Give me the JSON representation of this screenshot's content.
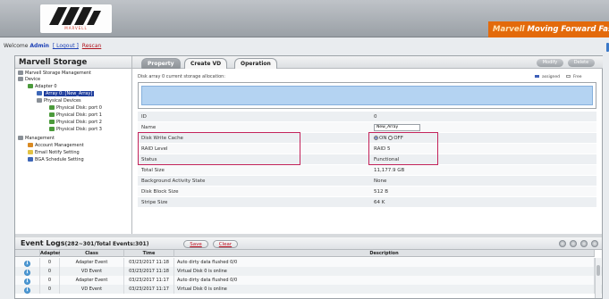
{
  "header": {
    "brand": "MARVELL",
    "tagline_accent": "Marvell",
    "tagline": "Moving Forward Faster"
  },
  "welcome": {
    "prefix": "Welcome",
    "user": "Admin",
    "logout": "[ Logout ]",
    "rescan": "Rescan"
  },
  "left": {
    "title": "Marvell Storage",
    "tree": [
      {
        "label": "Marvell Storage Management",
        "icon": "storage-management-icon"
      },
      {
        "label": "Device",
        "icon": "device-icon"
      },
      {
        "label": "Adapter 0",
        "icon": "adapter-icon"
      },
      {
        "label": "Array 0: [New_Array]",
        "icon": "array-icon",
        "selected": true
      },
      {
        "label": "Physical Devices",
        "icon": "folder-icon"
      },
      {
        "label": "Physical Disk: port 0",
        "icon": "disk-icon"
      },
      {
        "label": "Physical Disk: port 1",
        "icon": "disk-icon"
      },
      {
        "label": "Physical Disk: port 2",
        "icon": "disk-icon"
      },
      {
        "label": "Physical Disk: port 3",
        "icon": "disk-icon"
      },
      {
        "label": "Management",
        "icon": "management-icon"
      },
      {
        "label": "Account Management",
        "icon": "account-icon"
      },
      {
        "label": "Email Notify Setting",
        "icon": "email-icon"
      },
      {
        "label": "BGA Schedule Setting",
        "icon": "schedule-icon"
      }
    ]
  },
  "tabs": [
    "Property",
    "Create VD",
    "Operation"
  ],
  "top_buttons": [
    "Modify",
    "Delete"
  ],
  "allocation": {
    "label": "Disk array 0 current storage allocation:",
    "legend": [
      "assigned",
      "Free"
    ],
    "colors": {
      "assigned": "#3d5fb8",
      "free": "#ffffff",
      "fill": "#b4d3f2"
    }
  },
  "properties": [
    {
      "key": "ID",
      "value": "0"
    },
    {
      "key": "Name",
      "value": "New_Array",
      "input": true
    },
    {
      "key": "Disk Write Cache",
      "radio": [
        "ON",
        "OFF"
      ],
      "selected": "ON"
    },
    {
      "key": "RAID Level",
      "value": "RAID 5"
    },
    {
      "key": "Status",
      "value": "Functional"
    },
    {
      "key": "Total Size",
      "value": "11,177.9 GB"
    },
    {
      "key": "Background Activity State",
      "value": "None"
    },
    {
      "key": "Disk Block Size",
      "value": "512 B"
    },
    {
      "key": "Stripe Size",
      "value": "64 K"
    }
  ],
  "events": {
    "title": "Event Logs",
    "range": "(282~301/Total Events:301)",
    "save": "Save",
    "clear": "Clear",
    "columns": [
      "Adapter",
      "Class",
      "Time",
      "Description"
    ],
    "rows": [
      {
        "adapter": "0",
        "class": "Adapter Event",
        "time": "03/23/2017 11:18",
        "description": "Auto dirty data flushed 0/0"
      },
      {
        "adapter": "0",
        "class": "VD Event",
        "time": "03/23/2017 11:18",
        "description": "Virtual Disk 0 is online"
      },
      {
        "adapter": "0",
        "class": "Adapter Event",
        "time": "03/23/2017 11:17",
        "description": "Auto dirty data flushed 0/0"
      },
      {
        "adapter": "0",
        "class": "VD Event",
        "time": "03/23/2017 11:17",
        "description": "Virtual Disk 0 is online"
      }
    ]
  }
}
